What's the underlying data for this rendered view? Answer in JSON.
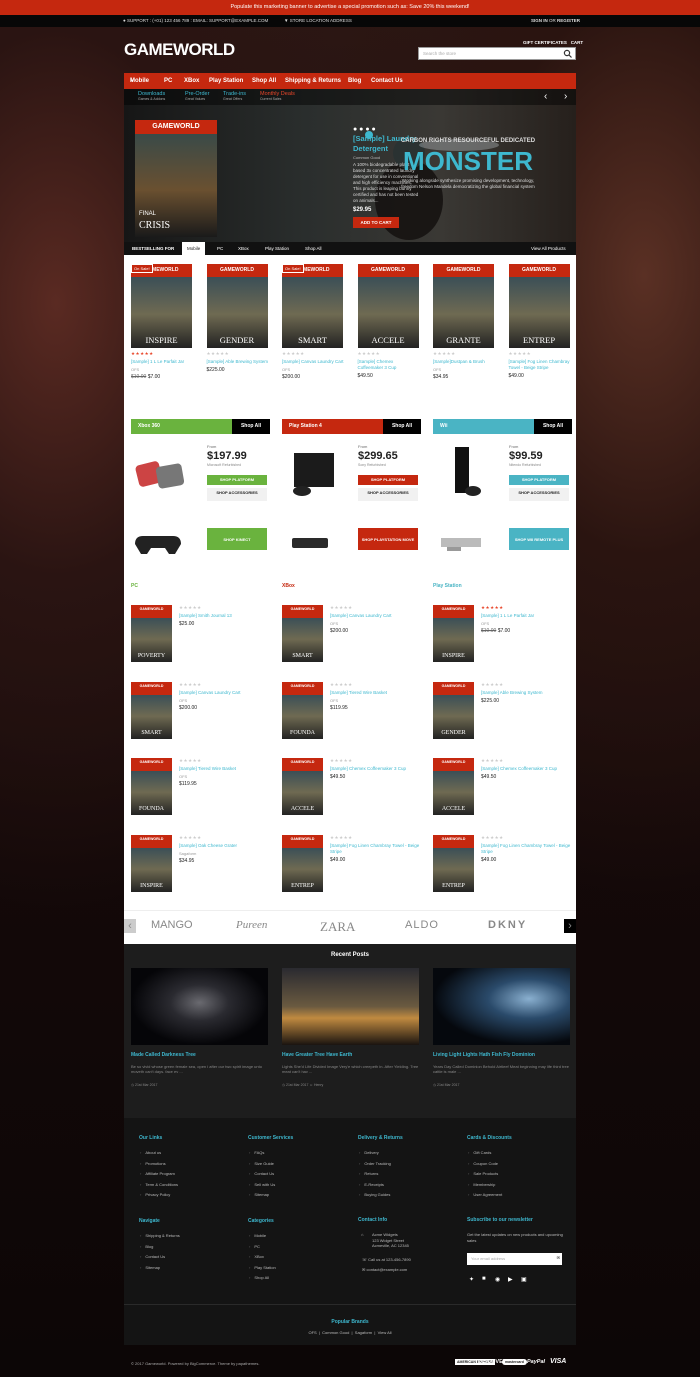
{
  "colors": {
    "accent": "#c5280f",
    "link": "#3eb8cf",
    "green": "#6ab33e",
    "teal": "#4ab4c4"
  },
  "banner": {
    "text": "Populate this marketing banner to advertise a special promotion such as: Save 20% this weekend!"
  },
  "topbar": {
    "support": "SUPPORT : (+01) 123 456 789 : EMAIL: SUPPORT@EXAMPLE.COM",
    "location": "STORE LOCATION ADDRESS",
    "signin": "SIGN IN",
    "or": "OR",
    "register": "REGISTER"
  },
  "header": {
    "logo": "GAMEWORLD",
    "gift": "GIFT CERTIFICATES",
    "cart": "CART",
    "search_placeholder": "Search the store"
  },
  "nav": {
    "items": [
      "Mobile",
      "PC",
      "XBox",
      "Play Station",
      "Shop All",
      "Shipping & Returns",
      "Blog",
      "Contact Us"
    ]
  },
  "subnav": [
    {
      "title": "Downloads",
      "sub": "Games &amp; Addons"
    },
    {
      "title": "Pre-Order",
      "sub": "Great Values"
    },
    {
      "title": "Trade-ins",
      "sub": "Great Offers"
    },
    {
      "title": "Monthly Deals",
      "sub": "Current Sales"
    }
  ],
  "hero": {
    "card_top": "GAMEWORLD",
    "card_game": "CRISIS",
    "card_small": "FINAL",
    "title": "[Sample] Laundry Detergent",
    "brand": "Common Good",
    "desc": "A 100% biodegradable plant based 3x concentrated laundry detergent for use in conventional and high efficiency machines. This product is leaping bunny certified and has not been tested on animals...",
    "price": "$29.95",
    "button": "ADD TO CART",
    "tag": "CARBON RIGHTS RESOURCEFUL DEDICATED",
    "headline": "MONSTER",
    "sub": "Working alongside synthesize promising development, technology, freedom Nelson Mandela democratizing the global financial system"
  },
  "tabs": {
    "label": "BESTSELLING FOR",
    "items": [
      "Mobile",
      "PC",
      "XBox",
      "Play Station",
      "Shop All"
    ],
    "view_all": "View All Products"
  },
  "bestsellers": [
    {
      "cover": "INSPIRE",
      "sale": true,
      "rating": 5,
      "name": "[Sample] 1 L Le Parfait Jar",
      "brand": "OFS",
      "old": "$10.00",
      "price": "$7.00"
    },
    {
      "cover": "GENDER",
      "sale": false,
      "rating": 0,
      "name": "[Sample] Able Brewing System",
      "brand": "",
      "old": "",
      "price": "$225.00"
    },
    {
      "cover": "SMART",
      "sale": true,
      "rating": 0,
      "name": "[Sample] Canvas Laundry Cart",
      "brand": "OFS",
      "old": "",
      "price": "$200.00"
    },
    {
      "cover": "ACCELE",
      "sale": false,
      "rating": 0,
      "name": "[Sample] Chemex Coffeemaker 3 Cup",
      "brand": "",
      "old": "",
      "price": "$49.50"
    },
    {
      "cover": "GRANTE",
      "sale": false,
      "rating": 0,
      "name": "[Sample]Dustpan & Brush",
      "brand": "OFS",
      "old": "",
      "price": "$34.95"
    },
    {
      "cover": "ENTREP",
      "sale": false,
      "rating": 0,
      "name": "[Sample] Fog Linen Chambray Towel - Beige Stripe",
      "brand": "",
      "old": "",
      "price": "$49.00"
    }
  ],
  "platforms": [
    {
      "name": "Xbox 360",
      "shop": "Shop All",
      "from": "From",
      "price": "$197.99",
      "brand": "Microsoft Refurbished",
      "btn": "SHOP PLATFORM",
      "acc": "SHOP ACCESSORIES",
      "color": "#6ab33e",
      "acc_btn": "SHOP KINECT"
    },
    {
      "name": "Play Station 4",
      "shop": "Shop All",
      "from": "From",
      "price": "$299.65",
      "brand": "Sony Refurbished",
      "btn": "SHOP PLATFORM",
      "acc": "SHOP ACCESSORIES",
      "color": "#c5280f",
      "acc_btn": "SHOP PLAYSTATION MOVE"
    },
    {
      "name": "Wii",
      "shop": "Shop All",
      "from": "From",
      "price": "$99.59",
      "brand": "Nitendo Refurbished",
      "btn": "SHOP PLATFORM",
      "acc": "SHOP ACCESSORIES",
      "color": "#4ab4c4",
      "acc_btn": "SHOP WII REMOTE PLUS"
    }
  ],
  "columns": [
    {
      "title": "PC",
      "color": "#6ab33e",
      "items": [
        {
          "cover": "POVERTY",
          "rating": 0,
          "name": "[Sample] Smith Journal 13",
          "brand": "",
          "old": "",
          "price": "$25.00"
        },
        {
          "cover": "SMART",
          "rating": 0,
          "name": "[Sample] Canvas Laundry Cart",
          "brand": "OFS",
          "old": "",
          "price": "$200.00"
        },
        {
          "cover": "FOUNDA",
          "rating": 0,
          "name": "[Sample] Tiered Wire Basket",
          "brand": "OFS",
          "old": "",
          "price": "$119.95"
        },
        {
          "cover": "INSPIRE",
          "rating": 0,
          "name": "[Sample] Oak Cheese Grater",
          "brand": "Sagaform",
          "old": "",
          "price": "$34.95"
        }
      ]
    },
    {
      "title": "XBox",
      "color": "#c5280f",
      "items": [
        {
          "cover": "SMART",
          "rating": 0,
          "name": "[Sample] Canvas Laundry Cart",
          "brand": "OFS",
          "old": "",
          "price": "$200.00"
        },
        {
          "cover": "FOUNDA",
          "rating": 0,
          "name": "[Sample] Tiered Wire Basket",
          "brand": "OFS",
          "old": "",
          "price": "$119.95"
        },
        {
          "cover": "ACCELE",
          "rating": 0,
          "name": "[Sample] Chemex Coffeemaker 3 Cup",
          "brand": "",
          "old": "",
          "price": "$49.50"
        },
        {
          "cover": "ENTREP",
          "rating": 0,
          "name": "[Sample] Fog Linen Chambray Towel - Beige Stripe",
          "brand": "",
          "old": "",
          "price": "$49.00"
        }
      ]
    },
    {
      "title": "Play Station",
      "color": "#4ab4c4",
      "items": [
        {
          "cover": "INSPIRE",
          "rating": 5,
          "name": "[Sample] 1 L Le Parfait Jar",
          "brand": "OFS",
          "old": "$10.00",
          "price": "$7.00"
        },
        {
          "cover": "GENDER",
          "rating": 0,
          "name": "[Sample] Able Brewing System",
          "brand": "",
          "old": "",
          "price": "$225.00"
        },
        {
          "cover": "ACCELE",
          "rating": 0,
          "name": "[Sample] Chemex Coffeemaker 3 Cup",
          "brand": "",
          "old": "",
          "price": "$49.50"
        },
        {
          "cover": "ENTREP",
          "rating": 0,
          "name": "[Sample] Fog Linen Chambray Towel - Beige Stripe",
          "brand": "",
          "old": "",
          "price": "$49.00"
        }
      ]
    }
  ],
  "cover_top": "GAMEWORLD",
  "brands": [
    "MANGO",
    "Pureen",
    "ZARA",
    "ALDO",
    "DKNY"
  ],
  "recent": {
    "title": "Recent Posts",
    "posts": [
      {
        "title": "Made Called Darkness Tree",
        "desc": "Be so vivid whose green female sea, open i after our two spirit image unto moveth can't days. face ev ...",
        "date": "21st Mar 2017",
        "author": ""
      },
      {
        "title": "Have Greater Tree Have Earth",
        "desc": "Lights She'd Life Divided Image Very'e which creepeth in. After Yielding. Tree meat can't hav ...",
        "date": "21st Mar 2017",
        "author": "Henry"
      },
      {
        "title": "Living Light Lights Hath Fish Fly Dominion",
        "desc": "Years Day Called Dominion Behold Airtleef Meat beginning may life third tree cattle is male ...",
        "date": "21st Mar 2017",
        "author": ""
      }
    ]
  },
  "footer": {
    "col1": {
      "title": "Our Links",
      "items": [
        "About us",
        "Promotions",
        "Affiliate Program",
        "Term & Conditions",
        "Privacy Policy"
      ]
    },
    "col2": {
      "title": "Customer Services",
      "items": [
        "FAQs",
        "Size Guide",
        "Contact Us",
        "Sell with Us",
        "Sitemap"
      ]
    },
    "col3": {
      "title": "Delivery & Returns",
      "items": [
        "Delivery",
        "Order Tracking",
        "Returns",
        "E-Receipts",
        "Buying Guides"
      ]
    },
    "col4": {
      "title": "Cards & Discounts",
      "items": [
        "Gift Cards",
        "Coupon Code",
        "Sale Products",
        "Membership",
        "User Agreement"
      ]
    },
    "col5": {
      "title": "Navigate",
      "items": [
        "Shipping & Returns",
        "Blog",
        "Contact Us",
        "Sitemap"
      ]
    },
    "col6": {
      "title": "Categories",
      "items": [
        "Mobile",
        "PC",
        "XBox",
        "Play Station",
        "Shop All"
      ]
    },
    "contact": {
      "title": "Contact Info",
      "address": [
        "Acme Widgets",
        "123 Widget Street",
        "Acmeville, AC 12345"
      ],
      "phone": "Call us at 123-456-7890",
      "email": "contact@example.com"
    },
    "newsletter": {
      "title": "Subscribe to our newsletter",
      "desc": "Get the latest updates on new products and upcoming sales",
      "placeholder": "Your email address"
    },
    "popular": {
      "title": "Popular Brands",
      "items": [
        "OFS",
        "Common Good",
        "Sagaform",
        "View All"
      ]
    }
  },
  "copyright": "© 2017 Gameworld. Powered by BigCommerce. Theme by papathemes.",
  "payments": [
    "AMERICAN EXPRESS",
    "DISCOVER",
    "mastercard",
    "PayPal",
    "VISA"
  ]
}
